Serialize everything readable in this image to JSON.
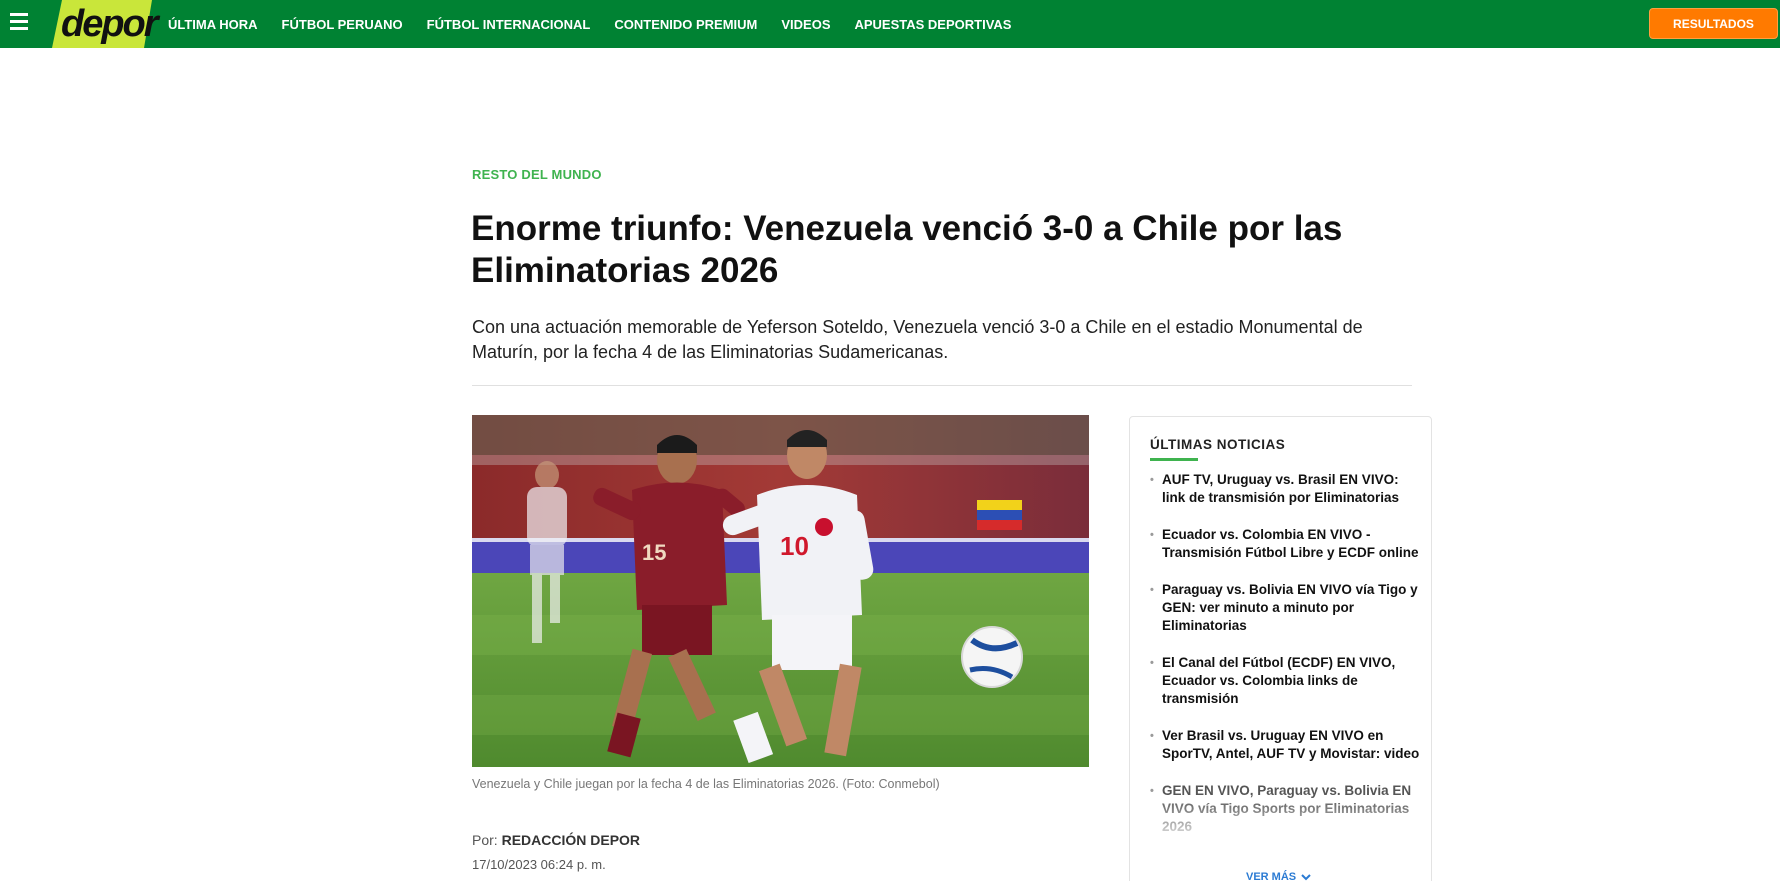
{
  "header": {
    "logo": "depor",
    "nav_items": [
      "ÚLTIMA HORA",
      "FÚTBOL PERUANO",
      "FÚTBOL INTERNACIONAL",
      "CONTENIDO PREMIUM",
      "VIDEOS",
      "APUESTAS DEPORTIVAS"
    ],
    "results_button": "RESULTADOS",
    "brand_color": "#008233",
    "accent_color": "#ff7a00"
  },
  "article": {
    "section": "RESTO DEL MUNDO",
    "title": "Enorme triunfo: Venezuela venció 3-0 a Chile por las Eliminatorias 2026",
    "summary": "Con una actuación memorable de Yeferson Soteldo, Venezuela venció 3-0 a Chile en el estadio Monumental de Maturín, por la fecha 4 de las Eliminatorias Sudamericanas.",
    "image_caption": "Venezuela y Chile juegan por la fecha 4 de las Eliminatorias 2026. (Foto: Conmebol)",
    "author_prefix": "Por:",
    "author": "REDACCIÓN DEPOR",
    "date": "17/10/2023 06:24 p. m."
  },
  "sidebar": {
    "title": "ÚLTIMAS NOTICIAS",
    "items": [
      "AUF TV, Uruguay vs. Brasil EN VIVO: link de transmisión por Eliminatorias",
      "Ecuador vs. Colombia EN VIVO - Transmisión Fútbol Libre y ECDF online",
      "Paraguay vs. Bolivia EN VIVO vía Tigo y GEN: ver minuto a minuto por Eliminatorias",
      "El Canal del Fútbol (ECDF) EN VIVO, Ecuador vs. Colombia links de transmisión",
      "Ver Brasil vs. Uruguay EN VIVO en SporTV, Antel, AUF TV y Movistar: video",
      "GEN EN VIVO, Paraguay vs. Bolivia EN VIVO vía Tigo Sports por Eliminatorias 2026"
    ],
    "see_more": "VER MÁS"
  }
}
